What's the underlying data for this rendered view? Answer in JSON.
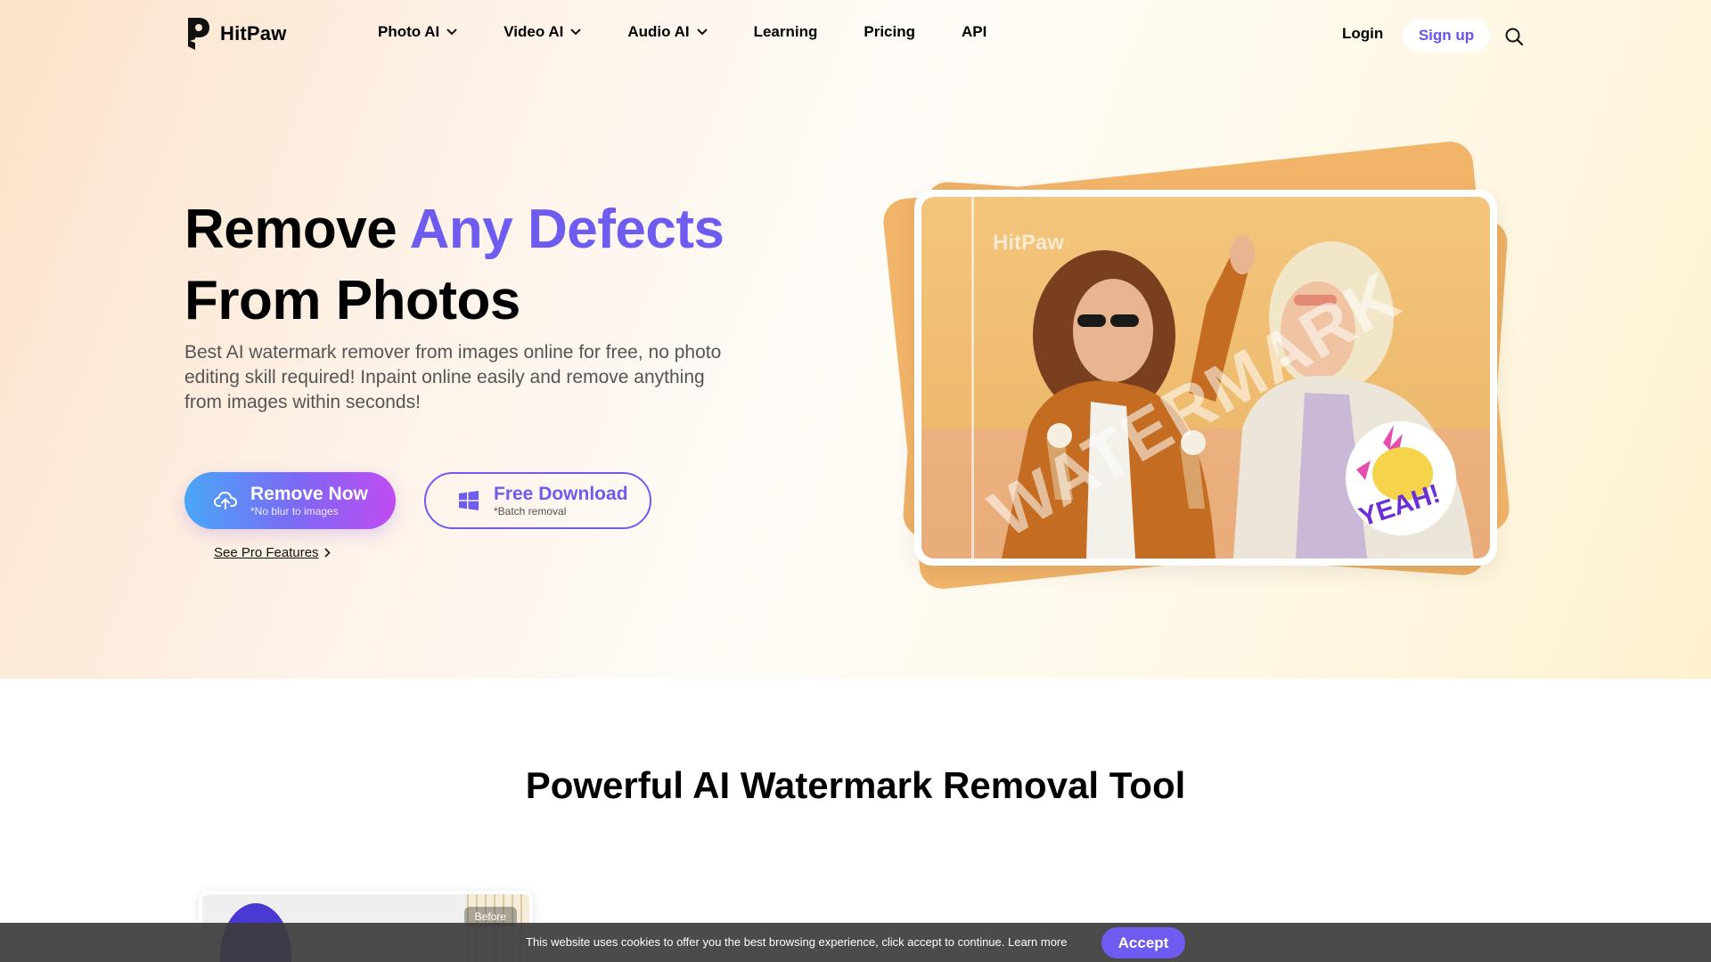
{
  "brand": {
    "name": "HitPaw",
    "accent": "#6e5cf1"
  },
  "nav": {
    "items": [
      {
        "label": "Photo AI",
        "dropdown": true
      },
      {
        "label": "Video AI",
        "dropdown": true
      },
      {
        "label": "Audio AI",
        "dropdown": true
      },
      {
        "label": "Learning",
        "dropdown": false
      },
      {
        "label": "Pricing",
        "dropdown": false
      },
      {
        "label": "API",
        "dropdown": false
      }
    ],
    "login": "Login",
    "signup": "Sign up",
    "search_icon": "search-icon"
  },
  "hero": {
    "title_part1": "Remove ",
    "title_accent": "Any Defects",
    "title_part2": "From Photos",
    "subtitle": "Best AI watermark remover from images online for free, no photo editing skill required! Inpaint online easily and remove anything from images within seconds!",
    "primary_button": {
      "title": "Remove Now",
      "note": "*No blur to images",
      "icon": "upload-cloud-icon"
    },
    "secondary_button": {
      "title": "Free Download",
      "note": "*Batch removal",
      "icon": "windows-icon"
    },
    "pro_link": "See Pro Features",
    "image": {
      "watermark_logo": "HitPaw",
      "watermark_text": "WATERMARK",
      "sticker": "YEAH!"
    }
  },
  "section2": {
    "title": "Powerful AI Watermark Removal Tool",
    "thumb_tag": "Before"
  },
  "cookie": {
    "text": "This website uses cookies to offer you the best browsing experience, click accept to continue.",
    "learn_more": "Learn more",
    "accept": "Accept"
  }
}
